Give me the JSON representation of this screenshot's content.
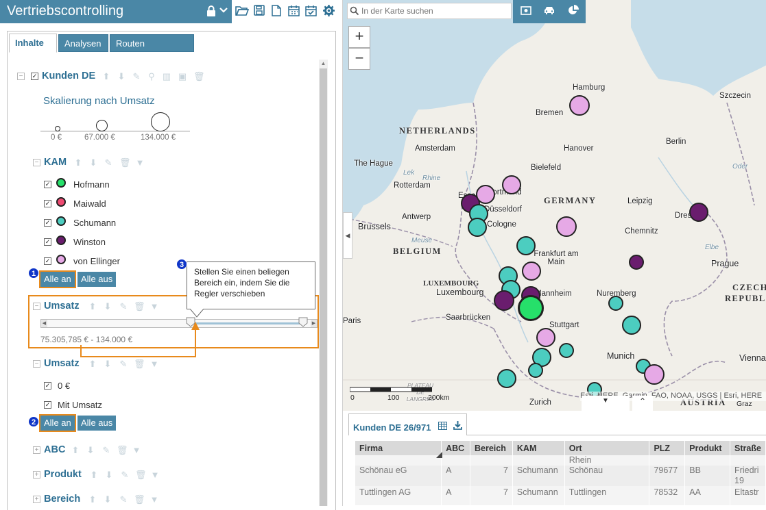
{
  "app": {
    "title": "Vertriebscontrolling"
  },
  "tabs": [
    {
      "label": "Inhalte"
    },
    {
      "label": "Analysen"
    },
    {
      "label": "Routen berechnen"
    }
  ],
  "layer": {
    "name": "Kunden DE"
  },
  "scaling": {
    "title": "Skalierung nach Umsatz",
    "labels": [
      "0 €",
      "67.000 €",
      "134.000 €"
    ]
  },
  "kam": {
    "title": "KAM",
    "items": [
      {
        "label": "Hofmann",
        "color": "#26e06a"
      },
      {
        "label": "Maiwald",
        "color": "#ee4a72"
      },
      {
        "label": "Schumann",
        "color": "#4ccdc0"
      },
      {
        "label": "Winston",
        "color": "#6a1d6e"
      },
      {
        "label": "von Ellinger",
        "color": "#e6a9e6"
      }
    ],
    "all_on": "Alle an",
    "all_off": "Alle aus"
  },
  "umsatz_range": {
    "title": "Umsatz",
    "range_text": "75.305,785 € - 134.000 €",
    "slider_low_fraction": 0.56,
    "slider_high_fraction": 1.0
  },
  "umsatz_filter": {
    "title": "Umsatz",
    "items": [
      {
        "label": "0 €"
      },
      {
        "label": "Mit Umsatz"
      }
    ],
    "all_on": "Alle an",
    "all_off": "Alle aus"
  },
  "other_filters": [
    {
      "title": "ABC"
    },
    {
      "title": "Produkt"
    },
    {
      "title": "Bereich"
    }
  ],
  "badges": [
    "1",
    "2",
    "3"
  ],
  "callout": {
    "text": "Stellen Sie einen beliegen Bereich ein, indem Sie die Regler verschieben"
  },
  "search": {
    "placeholder": "In der Karte suchen"
  },
  "map": {
    "zoom_in": "+",
    "zoom_out": "−",
    "countries": [
      "NETHERLANDS",
      "GERMANY",
      "BELGIUM",
      "LUXEMBOURG",
      "CZECH",
      "REPUBL",
      "AUSTRIA"
    ],
    "cities": [
      "Hamburg",
      "Bremen",
      "Szczecin",
      "Amsterdam",
      "Hanover",
      "Berlin",
      "The Hague",
      "Bielefeld",
      "Oder",
      "Rotterdam",
      "Lek",
      "Rhine",
      "Dortmund",
      "Essen",
      "Düsseldorf",
      "Leipzig",
      "Antwerp",
      "Brussels",
      "Cologne",
      "Chemnitz",
      "Dresden",
      "Meuse",
      "Frankfurt am Main",
      "Elbe",
      "Prague",
      "Luxembourg",
      "Mannheim",
      "Nuremberg",
      "Paris",
      "Saarbrücken",
      "Stuttgart",
      "Munich",
      "Vienna",
      "Zurich",
      "Graz",
      "PLATEAU DE LANGRES"
    ],
    "scale": {
      "labels": [
        "0",
        "100",
        "200km"
      ]
    },
    "attribution": "Esri, HERE, Garmin, FAO, NOAA, USGS | Esri, HERE"
  },
  "table": {
    "title": "Kunden DE 26/971",
    "columns": [
      "Firma",
      "ABC",
      "Bereich",
      "KAM",
      "Ort",
      "PLZ",
      "Produkt",
      "Straße"
    ],
    "rows": [
      [
        "",
        "",
        "",
        "",
        "Rhein",
        "",
        "",
        ""
      ],
      [
        "Schönau eG",
        "A",
        "7",
        "Schumann",
        "Schönau",
        "79677",
        "BB",
        "Friedri 19"
      ],
      [
        "Tuttlingen AG",
        "A",
        "7",
        "Schumann",
        "Tuttlingen",
        "78532",
        "AA",
        "Eltastr"
      ]
    ]
  }
}
